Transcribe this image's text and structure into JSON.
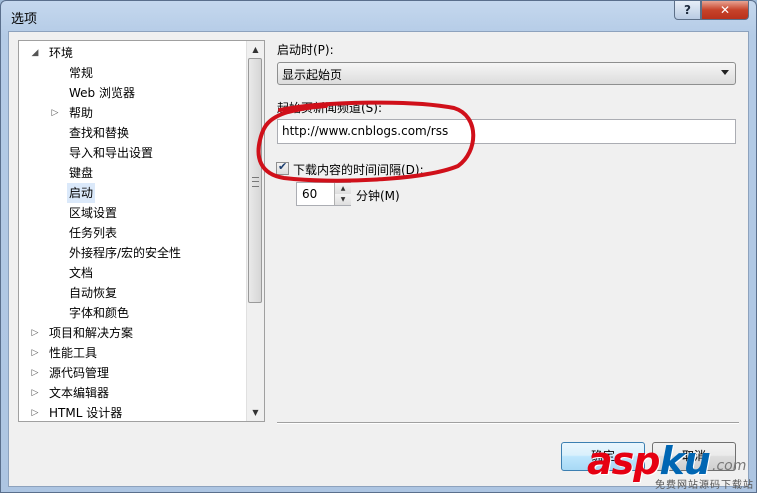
{
  "window": {
    "title": "选项",
    "help_label": "?",
    "close_label": "✕"
  },
  "tree": {
    "items": [
      {
        "label": "环境",
        "expanded": true
      },
      {
        "label": "常规"
      },
      {
        "label": "Web 浏览器"
      },
      {
        "label": "帮助",
        "collapsed": true
      },
      {
        "label": "查找和替换"
      },
      {
        "label": "导入和导出设置"
      },
      {
        "label": "键盘"
      },
      {
        "label": "启动",
        "selected": true
      },
      {
        "label": "区域设置"
      },
      {
        "label": "任务列表"
      },
      {
        "label": "外接程序/宏的安全性"
      },
      {
        "label": "文档"
      },
      {
        "label": "自动恢复"
      },
      {
        "label": "字体和颜色"
      },
      {
        "label": "项目和解决方案",
        "collapsed": true
      },
      {
        "label": "性能工具",
        "collapsed": true
      },
      {
        "label": "源代码管理",
        "collapsed": true
      },
      {
        "label": "文本编辑器",
        "collapsed": true
      },
      {
        "label": "HTML 设计器",
        "collapsed": true
      }
    ]
  },
  "startup": {
    "at_startup_label": "启动时(P):",
    "at_startup_value": "显示起始页",
    "news_channel_label": "起始页新闻频道(S):",
    "news_channel_value": "http://www.cnblogs.com/rss",
    "download_checkbox_label": "下载内容的时间间隔(D):",
    "download_checked": true,
    "interval_value": "60",
    "interval_unit": "分钟(M)"
  },
  "buttons": {
    "ok": "确定",
    "cancel": "取消"
  },
  "colors": {
    "annotation_red": "#d0101a",
    "selection": "#dbe9fa"
  },
  "watermark": {
    "main_a": "asp",
    "main_b": "ku",
    "domain": ".com",
    "sub": "免费网站源码下载站"
  }
}
